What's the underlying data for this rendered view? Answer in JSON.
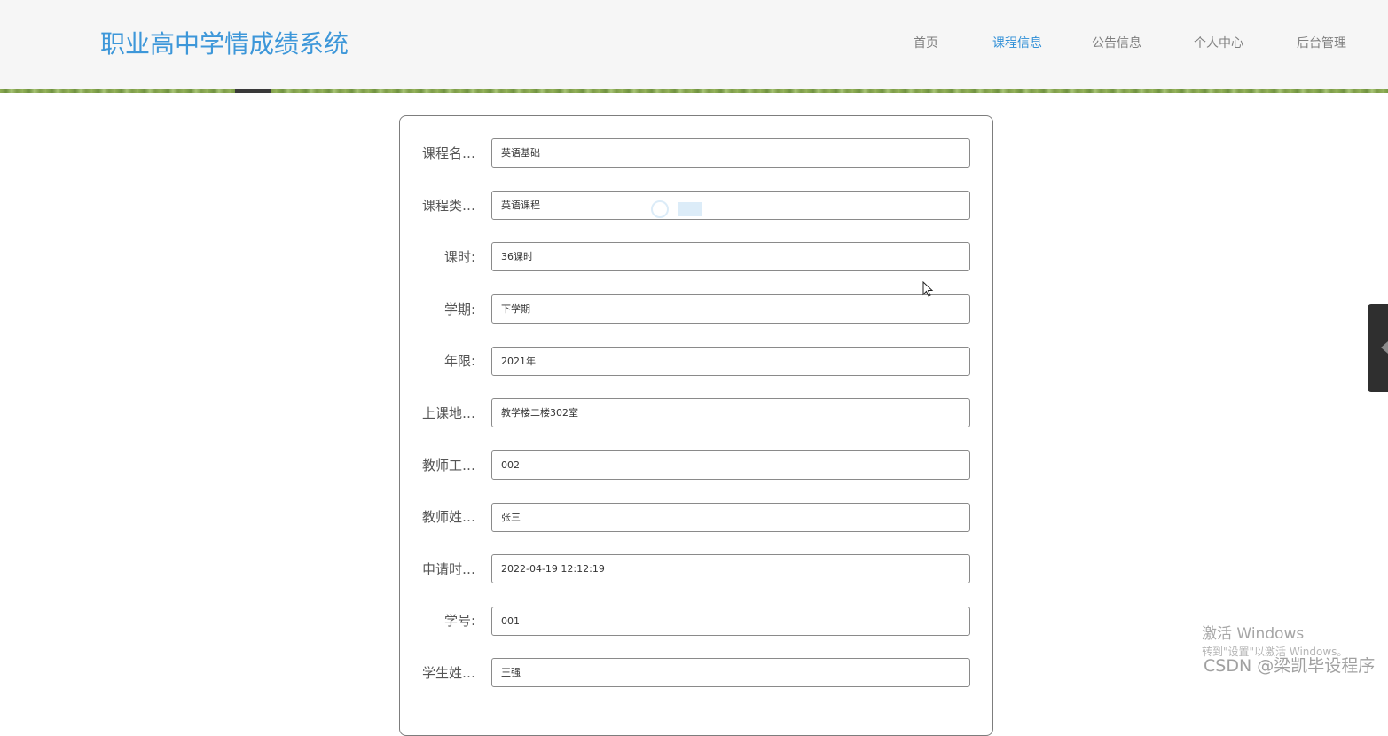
{
  "header": {
    "site_title": "职业高中学情成绩系统",
    "nav": [
      {
        "label": "首页",
        "active": false
      },
      {
        "label": "课程信息",
        "active": true
      },
      {
        "label": "公告信息",
        "active": false
      },
      {
        "label": "个人中心",
        "active": false
      },
      {
        "label": "后台管理",
        "active": false
      }
    ],
    "accent_color": "#3d97d9"
  },
  "form": {
    "fields": [
      {
        "label": "课程名…",
        "value": "英语基础"
      },
      {
        "label": "课程类…",
        "value": "英语课程"
      },
      {
        "label": "课时:",
        "value": "36课时"
      },
      {
        "label": "学期:",
        "value": "下学期"
      },
      {
        "label": "年限:",
        "value": "2021年"
      },
      {
        "label": "上课地…",
        "value": "教学楼二楼302室"
      },
      {
        "label": "教师工…",
        "value": "002"
      },
      {
        "label": "教师姓…",
        "value": "张三"
      },
      {
        "label": "申请时…",
        "value": "2022-04-19 12:12:19"
      },
      {
        "label": "学号:",
        "value": "001"
      },
      {
        "label": "学生姓…",
        "value": "王强"
      }
    ]
  },
  "overlay": {
    "windows_activation_title": "激活 Windows",
    "windows_activation_hint": "转到\"设置\"以激活 Windows。",
    "csdn_watermark": "CSDN @梁凯毕设程序"
  },
  "icons": {
    "cursor": "mouse-pointer-icon",
    "side_tab": "chevron-left-icon"
  }
}
